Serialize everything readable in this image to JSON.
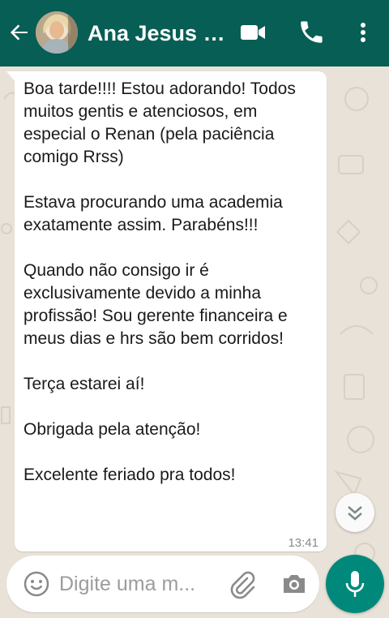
{
  "header": {
    "contact_name": "Ana Jesus S...",
    "color": "#075e54"
  },
  "message": {
    "text": "Boa tarde!!!! Estou adorando! Todos muitos gentis e atenciosos, em especial o Renan (pela paciência comigo Rrss)\n\nEstava procurando uma academia exatamente assim. Parabéns!!!\n\nQuando não consigo ir é exclusivamente devido a minha profissão! Sou gerente financeira e meus dias e hrs são bem corridos!\n\nTerça estarei aí!\n\nObrigada pela atenção!\n\nExcelente feriado pra todos!",
    "time": "13:41"
  },
  "input": {
    "placeholder": "Digite uma m..."
  },
  "icons": {
    "back": "arrow-left-icon",
    "video": "video-camera-icon",
    "call": "phone-icon",
    "more": "more-vertical-icon",
    "scroll": "chevron-double-down-icon",
    "emoji": "emoji-icon",
    "attach": "paperclip-icon",
    "camera": "camera-icon",
    "mic": "microphone-icon"
  },
  "colors": {
    "accent": "#00897b",
    "chat_background": "#e9e2d8"
  }
}
